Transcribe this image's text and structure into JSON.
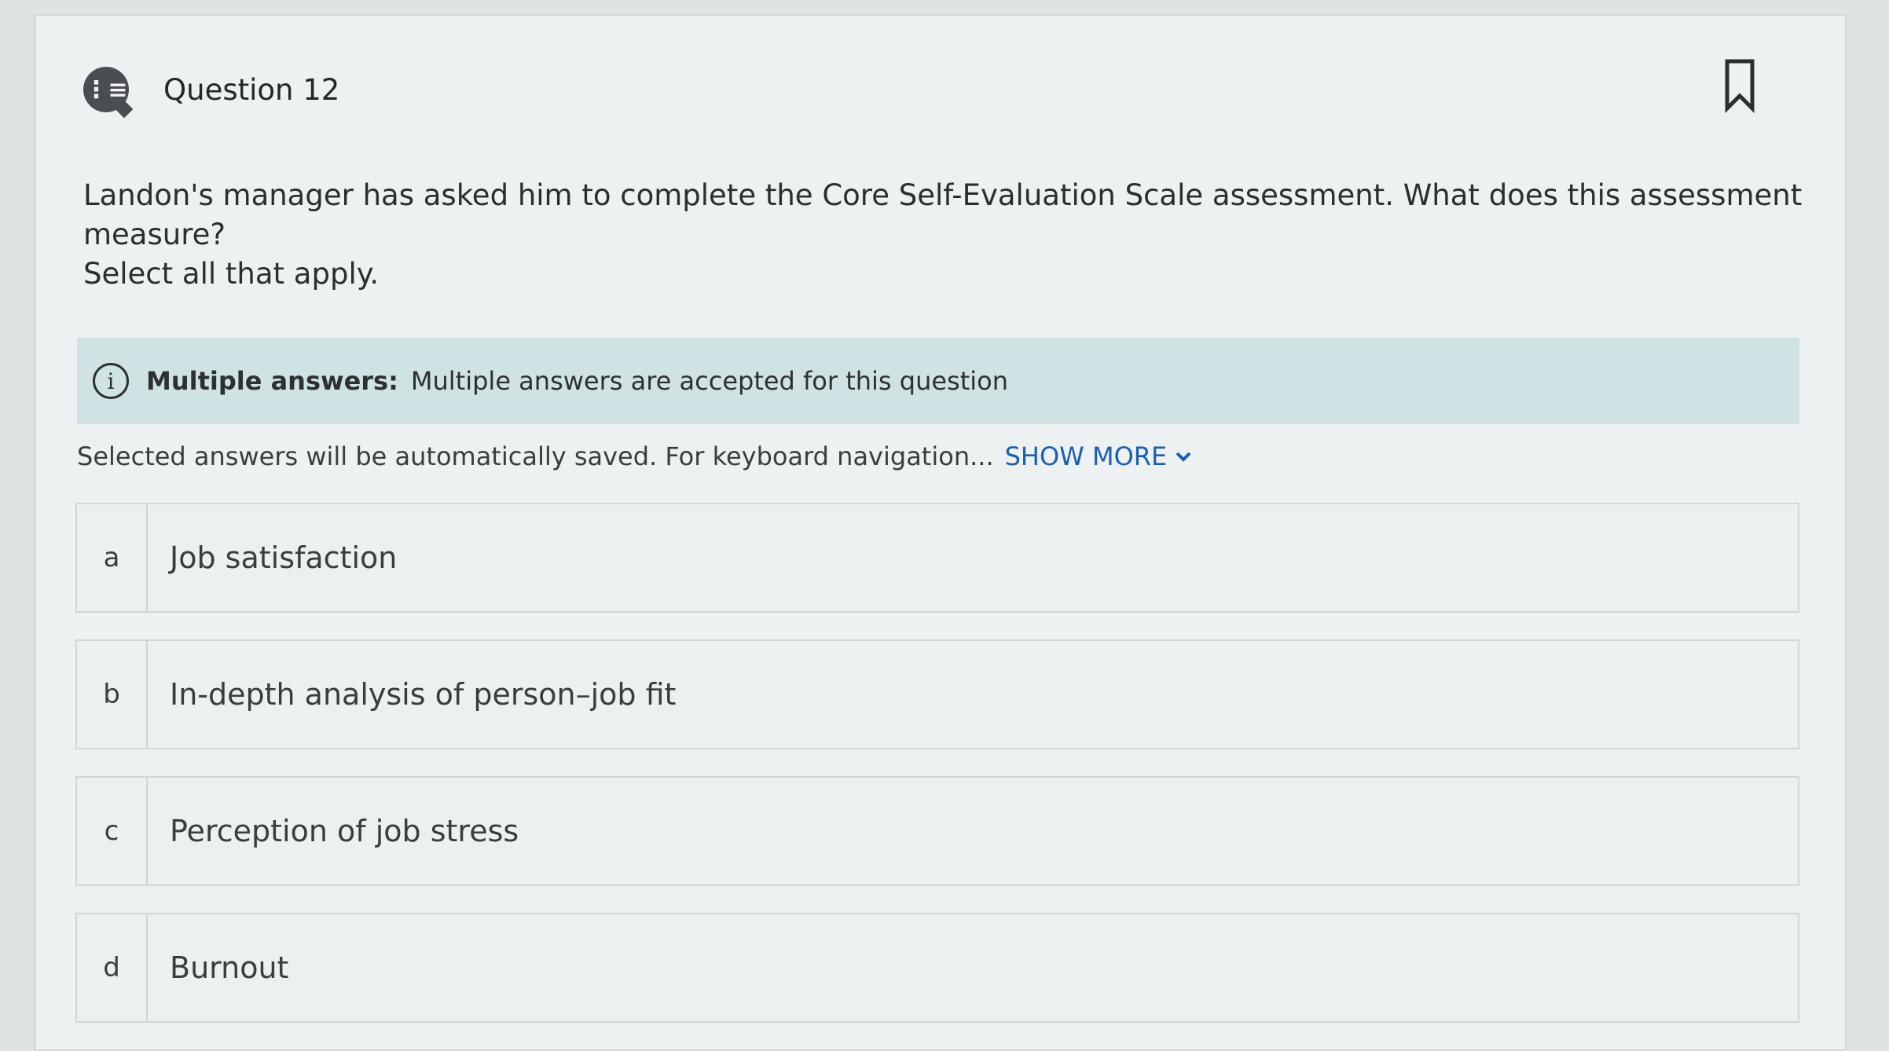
{
  "question": {
    "icon": "question-list-icon",
    "title": "Question 12",
    "bookmark_icon": "bookmark-icon",
    "prompt_line1": "Landon's manager has asked him to complete the Core Self-Evaluation Scale assessment. What does this assessment measure?",
    "prompt_line2": "Select all that apply."
  },
  "info": {
    "icon": "info-icon",
    "label": "Multiple answers:",
    "text": "Multiple answers are accepted for this question"
  },
  "save_note": {
    "text": "Selected answers will be automatically saved. For keyboard navigation...",
    "show_more": "SHOW MORE",
    "show_more_icon": "chevron-down-icon"
  },
  "answers": [
    {
      "letter": "a",
      "text": "Job satisfaction"
    },
    {
      "letter": "b",
      "text": "In-depth analysis of person–job fit"
    },
    {
      "letter": "c",
      "text": "Perception of job stress"
    },
    {
      "letter": "d",
      "text": "Burnout"
    }
  ],
  "colors": {
    "accent_link": "#1a5fb0",
    "info_bar_bg": "#cfe2e4",
    "icon_dark": "#4a4d52"
  }
}
